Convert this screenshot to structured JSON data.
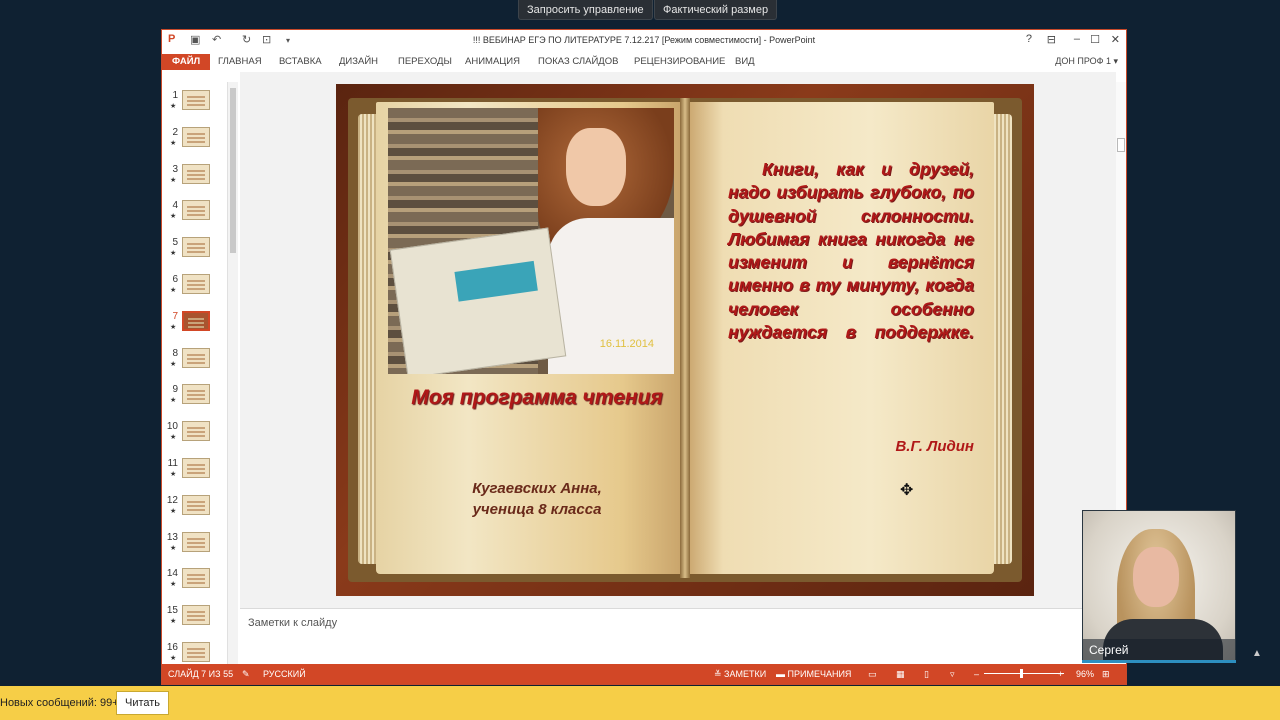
{
  "top_buttons": {
    "request_control": "Запросить управление",
    "actual_size": "Фактический размер"
  },
  "window": {
    "title": "!!! ВЕБИНАР ЕГЭ ПО ЛИТЕРАТУРЕ 7.12.217 [Режим совместимости] - PowerPoint",
    "controls": {
      "help": "?",
      "restore_ribbon": "⊟",
      "minimize": "–",
      "maximize": "☐",
      "close": "✕"
    }
  },
  "ribbon": {
    "tabs": [
      "ФАЙЛ",
      "ГЛАВНАЯ",
      "ВСТАВКА",
      "ДИЗАЙН",
      "ПЕРЕХОДЫ",
      "АНИМАЦИЯ",
      "ПОКАЗ СЛАЙДОВ",
      "РЕЦЕНЗИРОВАНИЕ",
      "ВИД"
    ],
    "user": "ДОН ПРОФ 1 ▾"
  },
  "thumbnails": [
    "1",
    "2",
    "3",
    "4",
    "5",
    "6",
    "7",
    "8",
    "9",
    "10",
    "11",
    "12",
    "13",
    "14",
    "15",
    "16"
  ],
  "active_slide": "7",
  "slide": {
    "photo_date": "16.11.2014",
    "program_title": "Моя программа чтения",
    "author_name": "Кугаевских Анна,",
    "author_class": "ученица 8 класса",
    "quote": "Книги, как и друзей, надо избирать глубоко, по душевной склонности. Любимая книга никогда не изменит и вернётся именно в ту минуту, когда человек особенно нуждается в поддержке.",
    "quote_author": "В.Г. Лидин"
  },
  "notes_placeholder": "Заметки к слайду",
  "status": {
    "slide_counter": "СЛАЙД 7 ИЗ 55",
    "language": "РУССКИЙ",
    "notes": "ЗАМЕТКИ",
    "comments": "ПРИМЕЧАНИЯ",
    "zoom": "96%"
  },
  "webcam": {
    "name": "Сергей"
  },
  "bottom": {
    "messages": "Новых сообщений: 99+",
    "read": "Читать"
  },
  "colors": {
    "accent": "#d24726",
    "quote_red": "#b01818",
    "bottom_bar": "#f6ce47"
  }
}
